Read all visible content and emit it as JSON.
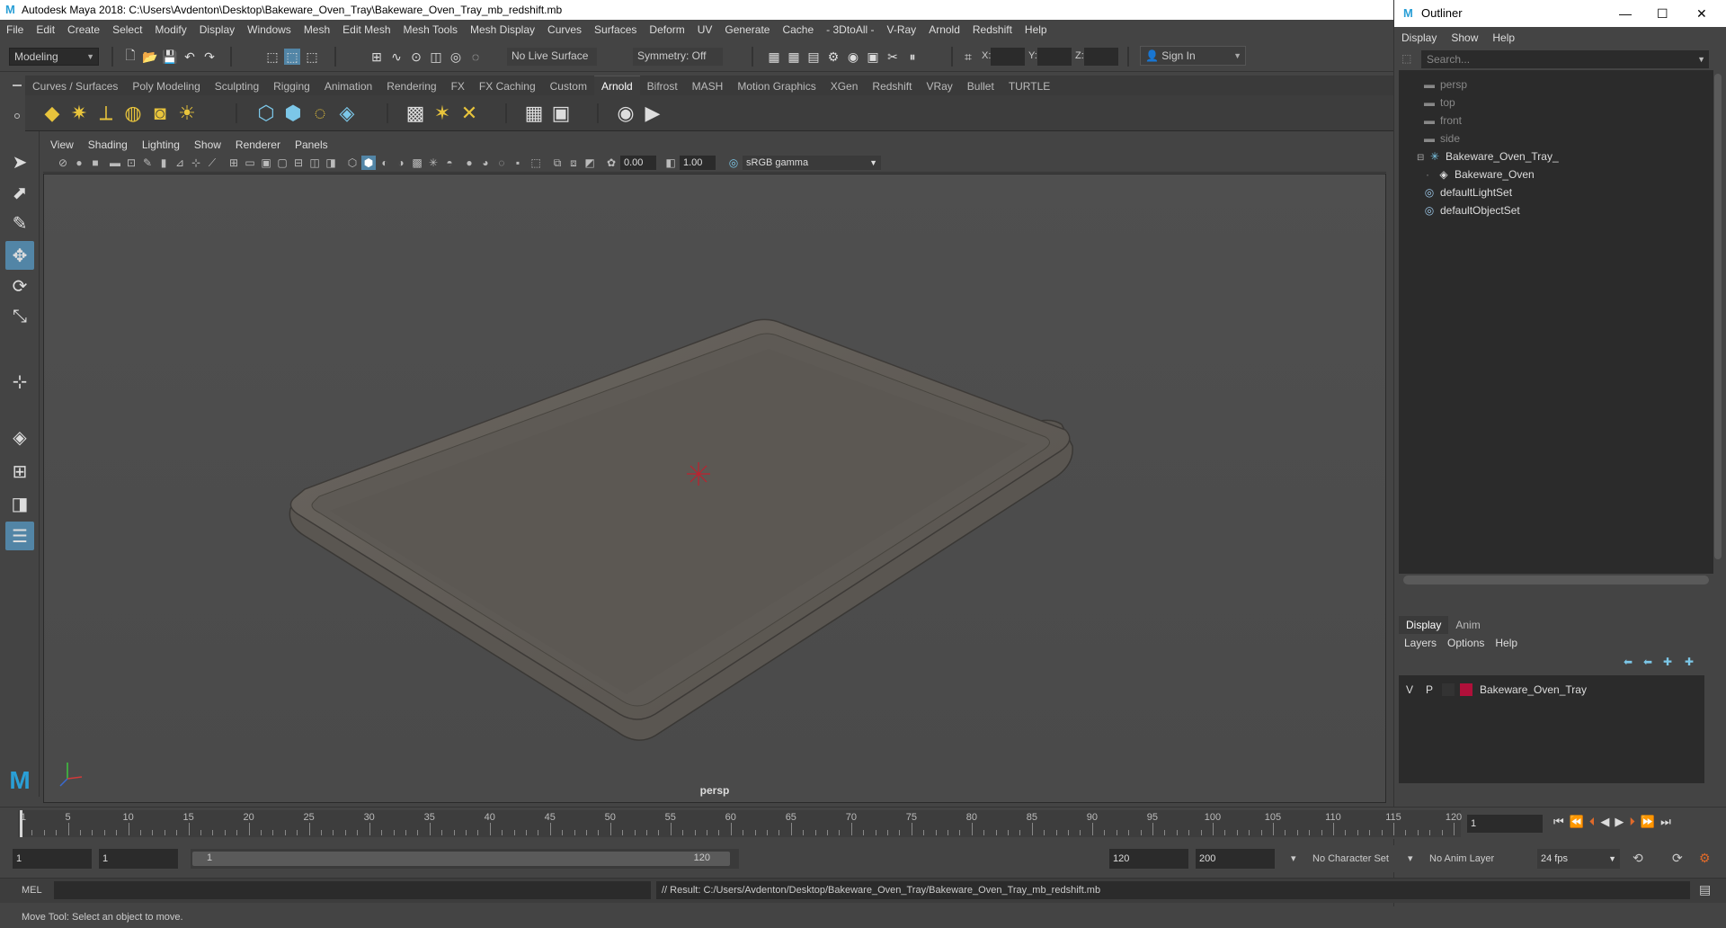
{
  "window": {
    "title": "Autodesk Maya 2018: C:\\Users\\Avdenton\\Desktop\\Bakeware_Oven_Tray\\Bakeware_Oven_Tray_mb_redshift.mb"
  },
  "menubar": [
    "File",
    "Edit",
    "Create",
    "Select",
    "Modify",
    "Display",
    "Windows",
    "Mesh",
    "Edit Mesh",
    "Mesh Tools",
    "Mesh Display",
    "Curves",
    "Surfaces",
    "Deform",
    "UV",
    "Generate",
    "Cache",
    "- 3DtoAll -",
    "V-Ray",
    "Arnold",
    "Redshift",
    "Help"
  ],
  "statusline": {
    "mode": "Modeling",
    "live_surface": "No Live Surface",
    "symmetry": "Symmetry: Off",
    "x_label": "X:",
    "y_label": "Y:",
    "z_label": "Z:",
    "sign_in": "Sign In"
  },
  "shelf_tabs": [
    "Curves / Surfaces",
    "Poly Modeling",
    "Sculpting",
    "Rigging",
    "Animation",
    "Rendering",
    "FX",
    "FX Caching",
    "Custom",
    "Arnold",
    "Bifrost",
    "MASH",
    "Motion Graphics",
    "XGen",
    "Redshift",
    "VRay",
    "Bullet",
    "TURTLE"
  ],
  "shelf_active": "Arnold",
  "viewport": {
    "menu": [
      "View",
      "Shading",
      "Lighting",
      "Show",
      "Renderer",
      "Panels"
    ],
    "exposure": "0.00",
    "gamma": "1.00",
    "color_space": "sRGB gamma",
    "camera_label": "persp"
  },
  "outliner": {
    "title": "Outliner",
    "menu": [
      "Display",
      "Show",
      "Help"
    ],
    "search_placeholder": "Search...",
    "items": [
      {
        "label": "persp",
        "type": "camera"
      },
      {
        "label": "top",
        "type": "camera"
      },
      {
        "label": "front",
        "type": "camera"
      },
      {
        "label": "side",
        "type": "camera"
      },
      {
        "label": "Bakeware_Oven_Tray_",
        "type": "group"
      },
      {
        "label": "Bakeware_Oven",
        "type": "mesh"
      },
      {
        "label": "defaultLightSet",
        "type": "set"
      },
      {
        "label": "defaultObjectSet",
        "type": "set"
      }
    ]
  },
  "layers": {
    "tabs": [
      "Display",
      "Anim"
    ],
    "menu": [
      "Layers",
      "Options",
      "Help"
    ],
    "row": {
      "v": "V",
      "p": "P",
      "name": "Bakeware_Oven_Tray",
      "color": "#b0103a"
    }
  },
  "timeline": {
    "ticks": [
      "1",
      "5",
      "10",
      "15",
      "20",
      "25",
      "30",
      "35",
      "40",
      "45",
      "50",
      "55",
      "60",
      "65",
      "70",
      "75",
      "80",
      "85",
      "90",
      "95",
      "100",
      "105",
      "110",
      "115",
      "120"
    ],
    "current_frame": "1"
  },
  "range": {
    "start": "1",
    "playback_start": "1",
    "slider_start": "1",
    "slider_end": "120",
    "playback_end": "120",
    "end": "200",
    "character_set": "No Character Set",
    "anim_layer": "No Anim Layer",
    "fps": "24 fps"
  },
  "cmdline": {
    "lang": "MEL",
    "result": "// Result: C:/Users/Avdenton/Desktop/Bakeware_Oven_Tray/Bakeware_Oven_Tray_mb_redshift.mb"
  },
  "helpline": "Move Tool: Select an object to move."
}
